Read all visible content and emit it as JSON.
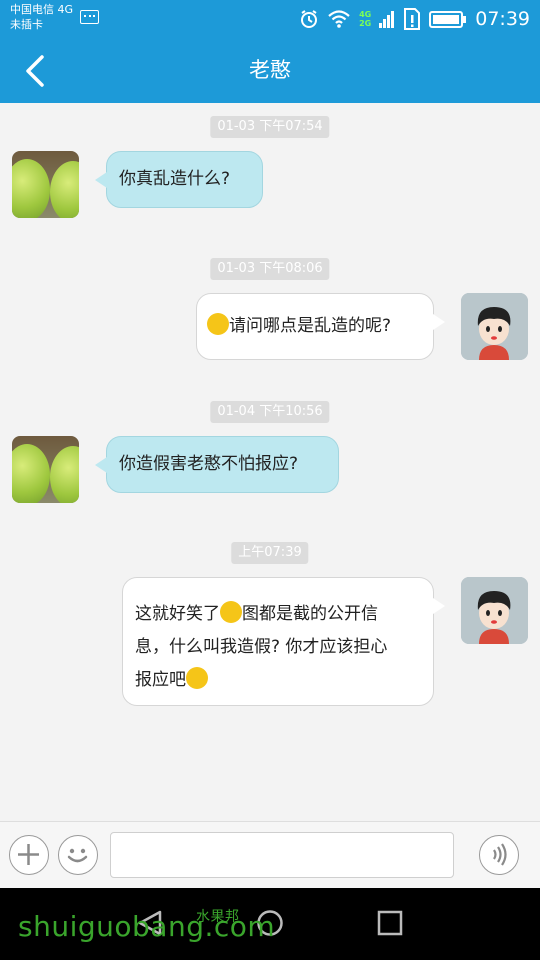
{
  "status_bar": {
    "carrier": "中国电信 4G",
    "sim": "未插卡",
    "time": "07:39",
    "net_top": "4G",
    "net_bottom": "2G"
  },
  "header": {
    "title": "老憨"
  },
  "messages": [
    {
      "timestamp": "01-03 下午07:54",
      "side": "left",
      "text": "你真乱造什么?"
    },
    {
      "timestamp": "01-03 下午08:06",
      "side": "right",
      "text": "请问哪点是乱造的呢?"
    },
    {
      "timestamp": "01-04 下午10:56",
      "side": "left",
      "text": "你造假害老憨不怕报应?"
    },
    {
      "timestamp": "上午07:39",
      "side": "right",
      "lines": [
        "这就好笑了",
        "图都是截的公开信",
        "息，什么叫我造假? 你才应该担心",
        "报应吧"
      ]
    }
  ],
  "input": {
    "placeholder": ""
  },
  "watermark": {
    "latin": "shuiguobang.com",
    "cn": "水果邦"
  },
  "colors": {
    "accent": "#1d9ad8",
    "left_bubble": "#bde8f0",
    "right_bubble": "#ffffff"
  }
}
